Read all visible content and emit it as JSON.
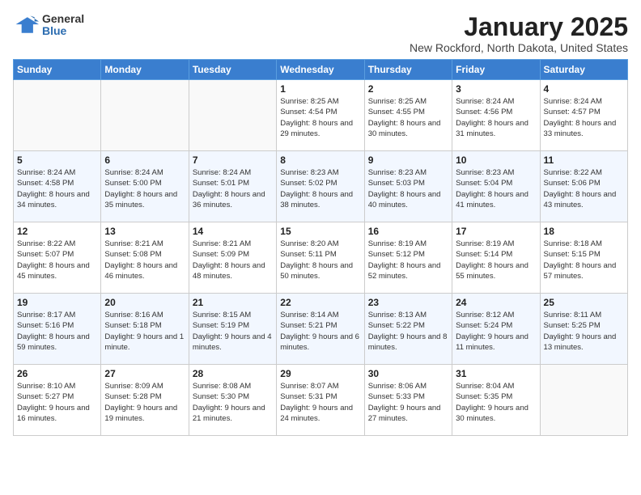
{
  "logo": {
    "general": "General",
    "blue": "Blue"
  },
  "title": "January 2025",
  "subtitle": "New Rockford, North Dakota, United States",
  "days_of_week": [
    "Sunday",
    "Monday",
    "Tuesday",
    "Wednesday",
    "Thursday",
    "Friday",
    "Saturday"
  ],
  "weeks": [
    [
      {
        "day": "",
        "info": ""
      },
      {
        "day": "",
        "info": ""
      },
      {
        "day": "",
        "info": ""
      },
      {
        "day": "1",
        "info": "Sunrise: 8:25 AM\nSunset: 4:54 PM\nDaylight: 8 hours and 29 minutes."
      },
      {
        "day": "2",
        "info": "Sunrise: 8:25 AM\nSunset: 4:55 PM\nDaylight: 8 hours and 30 minutes."
      },
      {
        "day": "3",
        "info": "Sunrise: 8:24 AM\nSunset: 4:56 PM\nDaylight: 8 hours and 31 minutes."
      },
      {
        "day": "4",
        "info": "Sunrise: 8:24 AM\nSunset: 4:57 PM\nDaylight: 8 hours and 33 minutes."
      }
    ],
    [
      {
        "day": "5",
        "info": "Sunrise: 8:24 AM\nSunset: 4:58 PM\nDaylight: 8 hours and 34 minutes."
      },
      {
        "day": "6",
        "info": "Sunrise: 8:24 AM\nSunset: 5:00 PM\nDaylight: 8 hours and 35 minutes."
      },
      {
        "day": "7",
        "info": "Sunrise: 8:24 AM\nSunset: 5:01 PM\nDaylight: 8 hours and 36 minutes."
      },
      {
        "day": "8",
        "info": "Sunrise: 8:23 AM\nSunset: 5:02 PM\nDaylight: 8 hours and 38 minutes."
      },
      {
        "day": "9",
        "info": "Sunrise: 8:23 AM\nSunset: 5:03 PM\nDaylight: 8 hours and 40 minutes."
      },
      {
        "day": "10",
        "info": "Sunrise: 8:23 AM\nSunset: 5:04 PM\nDaylight: 8 hours and 41 minutes."
      },
      {
        "day": "11",
        "info": "Sunrise: 8:22 AM\nSunset: 5:06 PM\nDaylight: 8 hours and 43 minutes."
      }
    ],
    [
      {
        "day": "12",
        "info": "Sunrise: 8:22 AM\nSunset: 5:07 PM\nDaylight: 8 hours and 45 minutes."
      },
      {
        "day": "13",
        "info": "Sunrise: 8:21 AM\nSunset: 5:08 PM\nDaylight: 8 hours and 46 minutes."
      },
      {
        "day": "14",
        "info": "Sunrise: 8:21 AM\nSunset: 5:09 PM\nDaylight: 8 hours and 48 minutes."
      },
      {
        "day": "15",
        "info": "Sunrise: 8:20 AM\nSunset: 5:11 PM\nDaylight: 8 hours and 50 minutes."
      },
      {
        "day": "16",
        "info": "Sunrise: 8:19 AM\nSunset: 5:12 PM\nDaylight: 8 hours and 52 minutes."
      },
      {
        "day": "17",
        "info": "Sunrise: 8:19 AM\nSunset: 5:14 PM\nDaylight: 8 hours and 55 minutes."
      },
      {
        "day": "18",
        "info": "Sunrise: 8:18 AM\nSunset: 5:15 PM\nDaylight: 8 hours and 57 minutes."
      }
    ],
    [
      {
        "day": "19",
        "info": "Sunrise: 8:17 AM\nSunset: 5:16 PM\nDaylight: 8 hours and 59 minutes."
      },
      {
        "day": "20",
        "info": "Sunrise: 8:16 AM\nSunset: 5:18 PM\nDaylight: 9 hours and 1 minute."
      },
      {
        "day": "21",
        "info": "Sunrise: 8:15 AM\nSunset: 5:19 PM\nDaylight: 9 hours and 4 minutes."
      },
      {
        "day": "22",
        "info": "Sunrise: 8:14 AM\nSunset: 5:21 PM\nDaylight: 9 hours and 6 minutes."
      },
      {
        "day": "23",
        "info": "Sunrise: 8:13 AM\nSunset: 5:22 PM\nDaylight: 9 hours and 8 minutes."
      },
      {
        "day": "24",
        "info": "Sunrise: 8:12 AM\nSunset: 5:24 PM\nDaylight: 9 hours and 11 minutes."
      },
      {
        "day": "25",
        "info": "Sunrise: 8:11 AM\nSunset: 5:25 PM\nDaylight: 9 hours and 13 minutes."
      }
    ],
    [
      {
        "day": "26",
        "info": "Sunrise: 8:10 AM\nSunset: 5:27 PM\nDaylight: 9 hours and 16 minutes."
      },
      {
        "day": "27",
        "info": "Sunrise: 8:09 AM\nSunset: 5:28 PM\nDaylight: 9 hours and 19 minutes."
      },
      {
        "day": "28",
        "info": "Sunrise: 8:08 AM\nSunset: 5:30 PM\nDaylight: 9 hours and 21 minutes."
      },
      {
        "day": "29",
        "info": "Sunrise: 8:07 AM\nSunset: 5:31 PM\nDaylight: 9 hours and 24 minutes."
      },
      {
        "day": "30",
        "info": "Sunrise: 8:06 AM\nSunset: 5:33 PM\nDaylight: 9 hours and 27 minutes."
      },
      {
        "day": "31",
        "info": "Sunrise: 8:04 AM\nSunset: 5:35 PM\nDaylight: 9 hours and 30 minutes."
      },
      {
        "day": "",
        "info": ""
      }
    ]
  ]
}
